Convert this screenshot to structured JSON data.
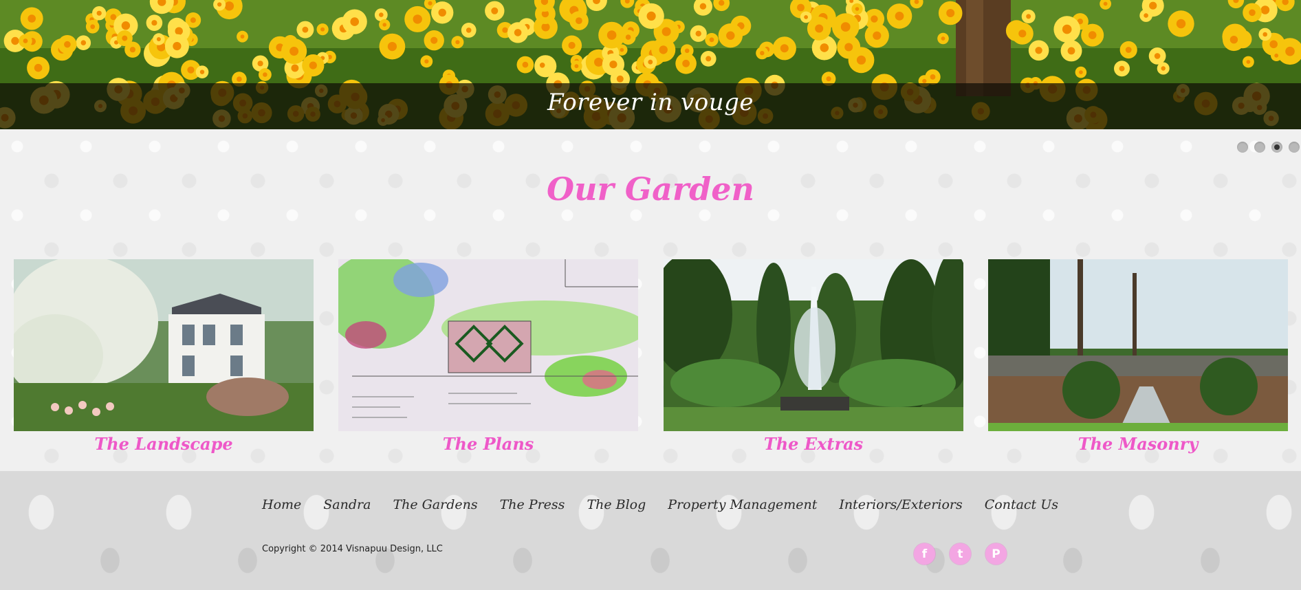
{
  "hero": {
    "caption": "Forever in vouge"
  },
  "slider": {
    "dot_count": 4,
    "active_index": 2
  },
  "section": {
    "title": "Our Garden"
  },
  "gallery": [
    {
      "caption": "The Landscape",
      "image_icon": "house-garden-photo"
    },
    {
      "caption": "The Plans",
      "image_icon": "garden-plan-sketch"
    },
    {
      "caption": "The Extras",
      "image_icon": "fountain-photo"
    },
    {
      "caption": "The Masonry",
      "image_icon": "stone-patio-photo"
    }
  ],
  "footer": {
    "nav": [
      "Home",
      "Sandra",
      "The Gardens",
      "The Press",
      "The Blog",
      "Property Management",
      "Interiors/Exteriors",
      "Contact Us"
    ],
    "copyright": "Copyright © 2014 Visnapuu Design, LLC",
    "social": [
      {
        "name": "facebook-icon",
        "glyph": "f"
      },
      {
        "name": "twitter-icon",
        "glyph": "t"
      },
      {
        "name": "pinterest-icon",
        "glyph": "P"
      }
    ]
  },
  "colors": {
    "accent_pink": "#ee58c8",
    "social_pink": "#f3a6e3"
  }
}
